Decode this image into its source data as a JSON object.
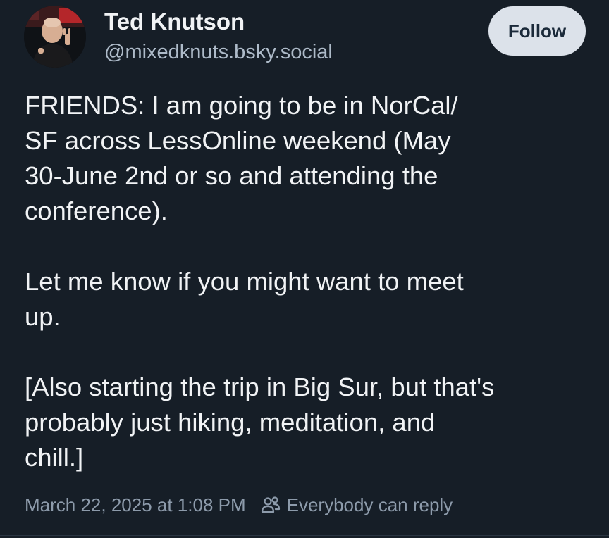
{
  "author": {
    "name": "Ted Knutson",
    "handle": "@mixedknuts.bsky.social",
    "avatar_icon": "profile-photo"
  },
  "actions": {
    "follow_label": "Follow"
  },
  "post": {
    "paragraphs": [
      "FRIENDS: I am going to be in NorCal/\nSF across LessOnline weekend (May\n30-June 2nd or so and attending the\nconference).",
      "Let me know if you might want to meet\nup.",
      "[Also starting the trip in Big Sur, but that's\nprobably just hiking, meditation, and\nchill.]"
    ],
    "timestamp": "March 22, 2025 at 1:08 PM",
    "reply_setting": "Everybody can reply",
    "reply_icon": "people-icon"
  },
  "colors": {
    "background": "#161e27",
    "text": "#f1f3f5",
    "handle": "#aebbc9",
    "meta": "#8d9bab",
    "follow_bg": "#dce2ea",
    "follow_text": "#1b2a3a"
  }
}
